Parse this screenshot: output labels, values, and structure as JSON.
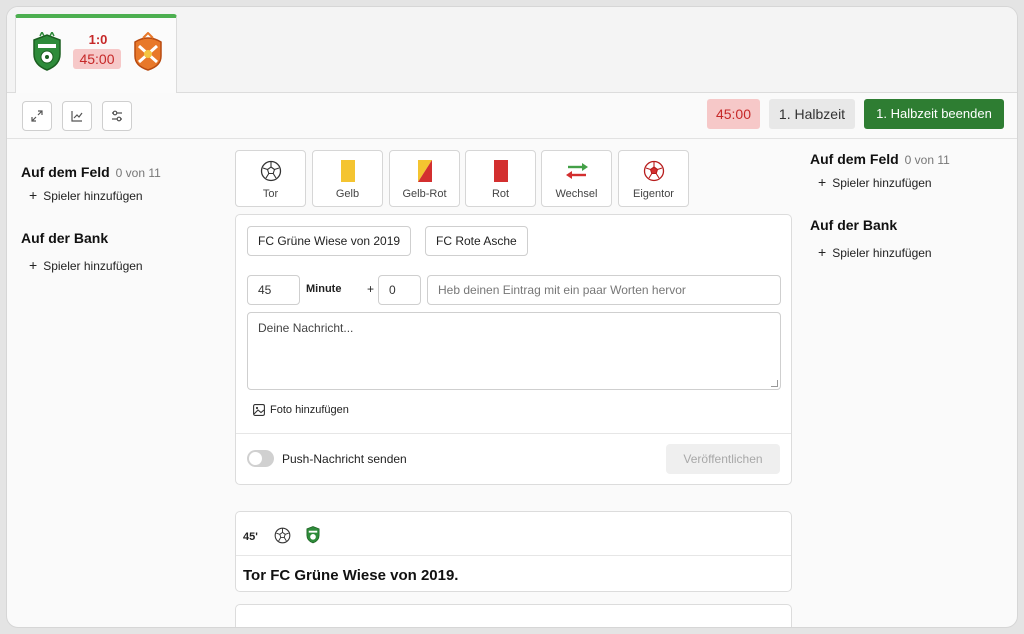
{
  "match_tab": {
    "score": "1:0",
    "time": "45:00"
  },
  "toolbar": {
    "timer": "45:00",
    "half": "1. Halbzeit",
    "end_half_label": "1. Halbzeit beenden"
  },
  "left_column": {
    "field_title": "Auf dem Feld",
    "field_count": "0 von 11",
    "field_add": "Spieler hinzufügen",
    "bench_title": "Auf der Bank",
    "bench_add": "Spieler hinzufügen"
  },
  "right_column": {
    "field_title": "Auf dem Feld",
    "field_count": "0 von 11",
    "field_add": "Spieler hinzufügen",
    "bench_title": "Auf der Bank",
    "bench_add": "Spieler hinzufügen"
  },
  "event_types": [
    {
      "label": "Tor",
      "icon": "football-icon"
    },
    {
      "label": "Gelb",
      "icon": "yellow-card-icon"
    },
    {
      "label": "Gelb-Rot",
      "icon": "yellow-red-card-icon"
    },
    {
      "label": "Rot",
      "icon": "red-card-icon"
    },
    {
      "label": "Wechsel",
      "icon": "substitution-icon"
    },
    {
      "label": "Eigentor",
      "icon": "own-goal-icon"
    }
  ],
  "composer": {
    "team_home": "FC Grüne Wiese von 2019",
    "team_away": "FC Rote Asche",
    "minute_value": "45",
    "minute_label": "Minute",
    "plus": "+",
    "extra_value": "0",
    "highlight_placeholder": "Heb deinen Eintrag mit ein paar Worten hervor",
    "message_placeholder": "Deine Nachricht...",
    "photo_label": "Foto hinzufügen",
    "push_label": "Push-Nachricht senden",
    "publish_label": "Veröffentlichen"
  },
  "feed": [
    {
      "minute": "45'",
      "headline": "Tor FC Grüne Wiese von 2019."
    }
  ],
  "colors": {
    "accent_green": "#2e7d32",
    "score_red": "#c62828",
    "timer_bg": "#f6c8c8"
  }
}
